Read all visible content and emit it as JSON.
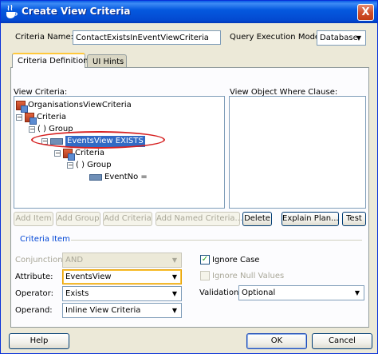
{
  "window": {
    "title": "Create View Criteria",
    "close_glyph": "X"
  },
  "header": {
    "criteria_name_label": "Criteria Name:",
    "criteria_name_value": "ContactExistsInEventViewCriteria",
    "query_mode_label": "Query Execution Mode:",
    "query_mode_value": "Database"
  },
  "tabs": [
    {
      "label": "Criteria Definition",
      "active": true
    },
    {
      "label": "UI Hints",
      "active": false
    }
  ],
  "criteria": {
    "view_criteria_label": "View Criteria:",
    "clause_label": "View Object Where Clause:",
    "tree": [
      {
        "label": "OrganisationsViewCriteria",
        "icon": "view-criteria-icon"
      },
      {
        "label": "Criteria",
        "icon": "criteria-icon"
      },
      {
        "label": "( ) Group",
        "icon": "group-icon"
      },
      {
        "label": "EventsView EXISTS",
        "icon": "row-icon",
        "selected": true
      },
      {
        "label": "Criteria",
        "icon": "criteria-icon"
      },
      {
        "label": "( ) Group",
        "icon": "group-icon"
      },
      {
        "label": "EventNo =",
        "icon": "row-icon"
      }
    ]
  },
  "toolbar": {
    "add_item": "Add Item",
    "add_group": "Add Group",
    "add_criteria": "Add Criteria",
    "add_named_criteria": "Add Named Criteria...",
    "delete": "Delete",
    "explain_plan": "Explain Plan...",
    "test": "Test"
  },
  "criteria_item": {
    "title": "Criteria Item",
    "conjunction_label": "Conjunction:",
    "conjunction_value": "AND",
    "attribute_label": "Attribute:",
    "attribute_value": "EventsView",
    "operator_label": "Operator:",
    "operator_value": "Exists",
    "operand_label": "Operand:",
    "operand_value": "Inline View Criteria",
    "ignore_case_label": "Ignore Case",
    "ignore_case_checked": true,
    "ignore_null_label": "Ignore Null Values",
    "ignore_null_checked": false,
    "validation_label": "Validation:",
    "validation_value": "Optional"
  },
  "footer": {
    "help": "Help",
    "ok": "OK",
    "cancel": "Cancel"
  }
}
